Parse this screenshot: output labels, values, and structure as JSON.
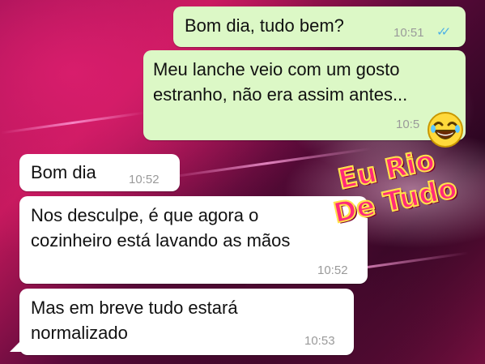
{
  "messages": [
    {
      "direction": "outgoing",
      "text": "Bom dia, tudo bem?",
      "time": "10:51",
      "read": "double-check-icon"
    },
    {
      "direction": "outgoing",
      "text": "Meu lanche veio com um gosto\nestranho, não era assim antes...",
      "time": "10:5"
    },
    {
      "direction": "incoming",
      "text": "Bom dia",
      "time": "10:52"
    },
    {
      "direction": "incoming",
      "text": "Nos desculpe, é que agora o\ncozinheiro está lavando as mãos",
      "time": "10:52"
    },
    {
      "direction": "incoming",
      "text": "Mas em breve tudo estará\nnormalizado",
      "time": "10:53"
    }
  ],
  "watermark": {
    "line1": "Eu Rio",
    "line2": "De Tudo",
    "emoji": "laughing-face-icon"
  },
  "colors": {
    "outgoing_bubble": "#dcf8c6",
    "incoming_bubble": "#ffffff",
    "read_ticks": "#4fb1e6",
    "logo_fill": "#ff2a7a",
    "logo_outline": "#ffe14a"
  }
}
